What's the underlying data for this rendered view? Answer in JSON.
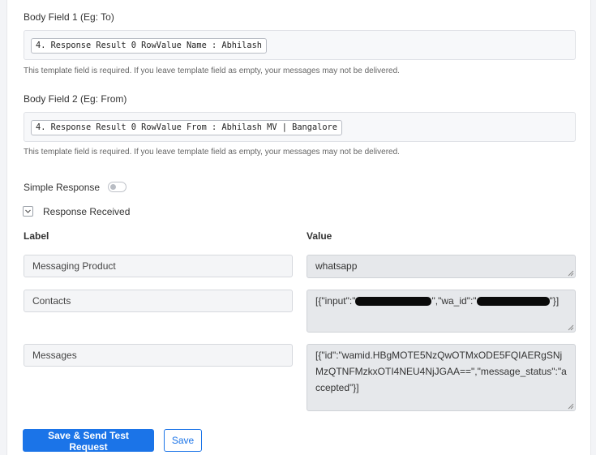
{
  "body_field_1": {
    "label": "Body Field 1 (Eg: To)",
    "value": "4. Response Result 0 RowValue Name : Abhilash",
    "hint": "This template field is required. If you leave template field as empty, your messages may not be delivered."
  },
  "body_field_2": {
    "label": "Body Field 2 (Eg: From)",
    "value": "4. Response Result 0 RowValue From : Abhilash MV | Bangalore",
    "hint": "This template field is required. If you leave template field as empty, your messages may not be delivered."
  },
  "simple_response": {
    "label": "Simple Response",
    "enabled": false
  },
  "response_received": {
    "label": "Response Received",
    "expanded": true
  },
  "table": {
    "label_header": "Label",
    "value_header": "Value",
    "rows": [
      {
        "label": "Messaging Product",
        "value": "whatsapp"
      },
      {
        "label": "Contacts",
        "value_prefix": "[{\"input\":\"",
        "value_middle": "\",\"wa_id\":\"",
        "value_suffix": "\"}]"
      },
      {
        "label": "Messages",
        "value": "[{\"id\":\"wamid.HBgMOTE5NzQwOTMxODE5FQIAERgSNjMzQTNFMzkxOTI4NEU4NjJGAA==\",\"message_status\":\"accepted\"}]"
      }
    ]
  },
  "buttons": {
    "save_send": "Save & Send Test Request",
    "save": "Save"
  },
  "colors": {
    "primary": "#1b74e8",
    "field_bg": "#f7f8fa",
    "value_bg": "#e6e8eb"
  }
}
